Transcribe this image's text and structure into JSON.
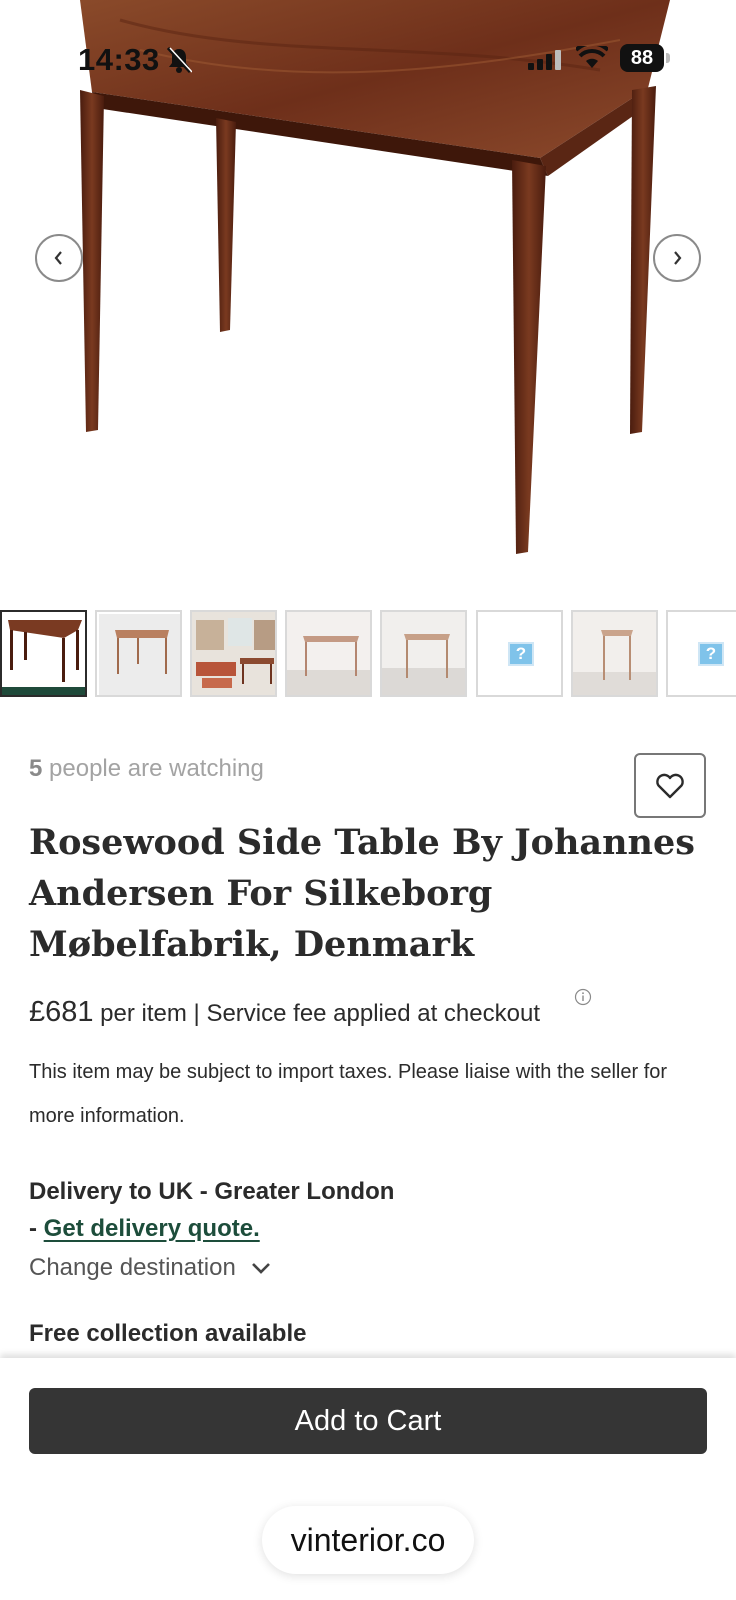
{
  "status_bar": {
    "time": "14:33",
    "battery": "88"
  },
  "product": {
    "watching_count": "5",
    "watching_text": " people are watching",
    "title": "Rosewood Side Table By Johannes Andersen For Silkeborg Møbelfabrik, Denmark",
    "price": "£681",
    "price_suffix": " per item | Service fee applied at checkout",
    "tax_note": "This item may be subject to import taxes. Please liaise with the seller for more information."
  },
  "delivery": {
    "heading": "Delivery to UK - Greater London",
    "dash": "- ",
    "quote_link": "Get delivery quote.",
    "change_destination": "Change destination",
    "collection": "Free collection available"
  },
  "actions": {
    "add_to_cart": "Add to Cart"
  },
  "browser": {
    "url": "vinterior.co"
  },
  "thumbnails": [
    "table-photo",
    "table-photo",
    "room-photo",
    "table-photo",
    "table-photo",
    "missing-image",
    "table-photo",
    "missing-image"
  ],
  "colors": {
    "wood": "#7a3a22",
    "accent_green": "#1f4a3a",
    "cart_button": "#353535",
    "link": "#1d4d3b"
  }
}
